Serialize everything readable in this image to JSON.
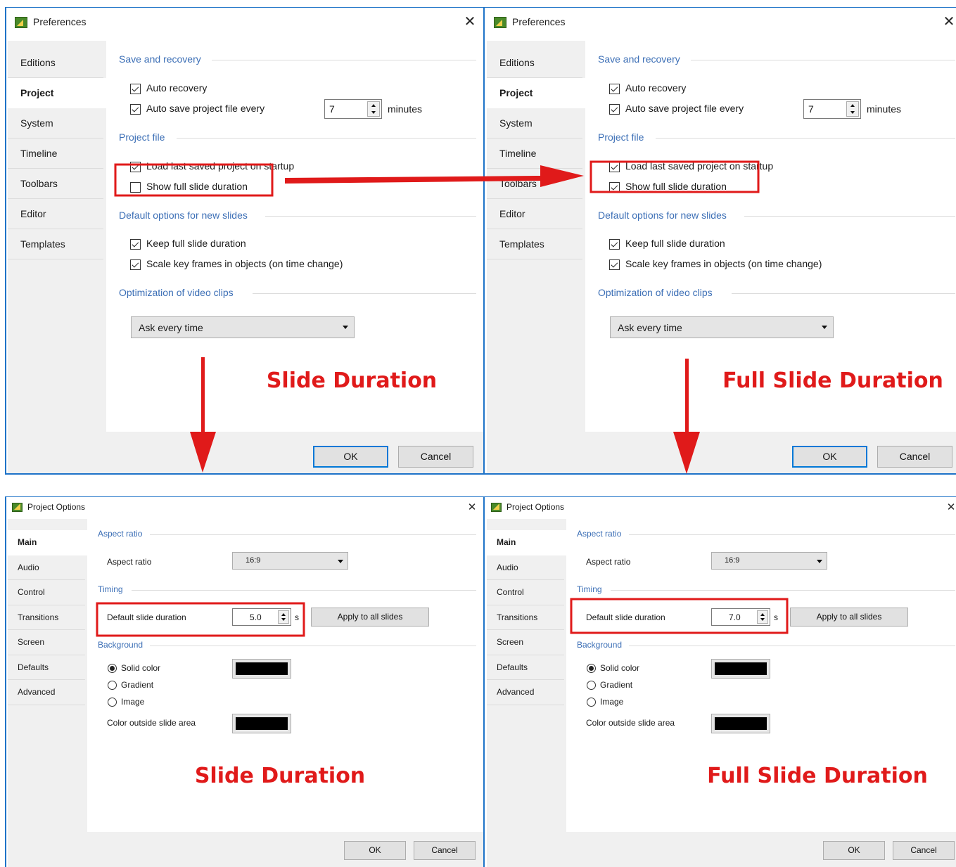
{
  "top_left": {
    "title": "Preferences",
    "tabs": [
      "Editions",
      "Project",
      "System",
      "Timeline",
      "Toolbars",
      "Editor",
      "Templates"
    ],
    "active_tab": "Project",
    "sections": {
      "save_recovery": "Save and recovery",
      "project_file": "Project file",
      "default_options": "Default options for new slides",
      "optimization": "Optimization of video clips"
    },
    "checkboxes": {
      "auto_recovery": {
        "label": "Auto recovery",
        "checked": true
      },
      "auto_save": {
        "label": "Auto save project file every",
        "checked": true
      },
      "load_last": {
        "label": "Load last saved project on startup",
        "checked": true
      },
      "show_full": {
        "label": "Show full slide duration",
        "checked": false
      },
      "keep_full": {
        "label": "Keep full slide duration",
        "checked": true
      },
      "scale_keyframes": {
        "label": "Scale key frames in objects (on time change)",
        "checked": true
      }
    },
    "auto_save_value": "7",
    "minutes_label": "minutes",
    "optimization_value": "Ask every time",
    "ok_label": "OK",
    "cancel_label": "Cancel",
    "caption": "Slide Duration"
  },
  "top_right": {
    "title": "Preferences",
    "tabs": [
      "Editions",
      "Project",
      "System",
      "Timeline",
      "Toolbars",
      "Editor",
      "Templates"
    ],
    "active_tab": "Project",
    "sections": {
      "save_recovery": "Save and recovery",
      "project_file": "Project file",
      "default_options": "Default options for new slides",
      "optimization": "Optimization of video clips"
    },
    "checkboxes": {
      "auto_recovery": {
        "label": "Auto recovery",
        "checked": true
      },
      "auto_save": {
        "label": "Auto save project file every",
        "checked": true
      },
      "load_last": {
        "label": "Load last saved project on startup",
        "checked": true
      },
      "show_full": {
        "label": "Show full slide duration",
        "checked": true
      },
      "keep_full": {
        "label": "Keep full slide duration",
        "checked": true
      },
      "scale_keyframes": {
        "label": "Scale key frames in objects (on time change)",
        "checked": true
      }
    },
    "auto_save_value": "7",
    "minutes_label": "minutes",
    "optimization_value": "Ask every time",
    "ok_label": "OK",
    "cancel_label": "Cancel",
    "caption": "Full Slide Duration"
  },
  "bottom_left": {
    "title": "Project Options",
    "tabs": [
      "Main",
      "Audio",
      "Control",
      "Transitions",
      "Screen",
      "Defaults",
      "Advanced"
    ],
    "active_tab": "Main",
    "sections": {
      "aspect": "Aspect ratio",
      "timing": "Timing",
      "background": "Background"
    },
    "aspect_label": "Aspect ratio",
    "aspect_value": "16:9",
    "duration_label": "Default slide duration",
    "duration_value": "5.0",
    "duration_unit": "s",
    "apply_label": "Apply to all slides",
    "radios": {
      "solid": "Solid color",
      "gradient": "Gradient",
      "image": "Image"
    },
    "selected_radio": "solid",
    "outside_label": "Color outside slide area",
    "ok_label": "OK",
    "cancel_label": "Cancel",
    "caption": "Slide Duration"
  },
  "bottom_right": {
    "title": "Project Options",
    "tabs": [
      "Main",
      "Audio",
      "Control",
      "Transitions",
      "Screen",
      "Defaults",
      "Advanced"
    ],
    "active_tab": "Main",
    "sections": {
      "aspect": "Aspect ratio",
      "timing": "Timing",
      "background": "Background"
    },
    "aspect_label": "Aspect ratio",
    "aspect_value": "16:9",
    "duration_label": "Default slide duration",
    "duration_value": "7.0",
    "duration_unit": "s",
    "apply_label": "Apply to all slides",
    "radios": {
      "solid": "Solid color",
      "gradient": "Gradient",
      "image": "Image"
    },
    "selected_radio": "solid",
    "outside_label": "Color outside slide area",
    "ok_label": "OK",
    "cancel_label": "Cancel",
    "caption": "Full Slide Duration"
  },
  "colors": {
    "annotation_red": "#e01a1a",
    "section_blue": "#3c6fb6",
    "focus_blue": "#0078d7",
    "swatch": "#000000"
  }
}
